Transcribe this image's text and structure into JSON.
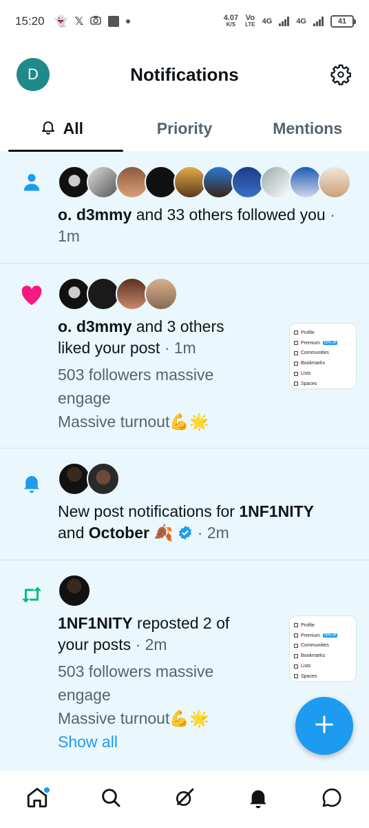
{
  "status_bar": {
    "time": "15:20",
    "net_speed_value": "4.07",
    "net_speed_unit": "K/S",
    "volte_top": "Vo",
    "volte_bottom": "LTE",
    "sim1_label": "4G",
    "sim2_label": "4G",
    "battery": "41"
  },
  "header": {
    "avatar_letter": "D",
    "title": "Notifications"
  },
  "tabs": [
    {
      "label": "All",
      "active": true
    },
    {
      "label": "Priority",
      "active": false
    },
    {
      "label": "Mentions",
      "active": false
    }
  ],
  "notifications": [
    {
      "type": "follow",
      "icon": "person-icon",
      "actor": "o. d3mmy",
      "text": "and 33 others followed you",
      "time": "1m",
      "avatars": 10
    },
    {
      "type": "like",
      "icon": "heart-icon",
      "actor": "o. d3mmy",
      "text_line1": "and 3 others",
      "text_line2": "liked your post",
      "time": "1m",
      "post_line1": "503 followers massive",
      "post_line2": "engage",
      "post_line3": "Massive turnout💪🌟",
      "avatars": 4
    },
    {
      "type": "post_notifications",
      "icon": "bell-icon",
      "text": "New post notifications for",
      "actor1": "1NF1NITY",
      "connector": "and",
      "actor2": "October 🍂",
      "time": "2m",
      "avatars": 2
    },
    {
      "type": "repost",
      "icon": "repost-icon",
      "actor": "1NF1NITY",
      "text_line1": "reposted 2 of",
      "text_line2": "your posts",
      "time": "2m",
      "post_line1": "503 followers massive",
      "post_line2": "engage",
      "post_line3": "Massive turnout💪🌟",
      "show_all": "Show all",
      "avatars": 1
    }
  ],
  "preview_menu": {
    "items": [
      "Profile",
      "Premium",
      "Communities",
      "Bookmarks",
      "Lists",
      "Spaces"
    ],
    "premium_badge": "50% off"
  },
  "colors": {
    "accent": "#1d9bf0",
    "like": "#f91880",
    "repost": "#00ba7c",
    "feed_bg": "#eaf7fd"
  }
}
